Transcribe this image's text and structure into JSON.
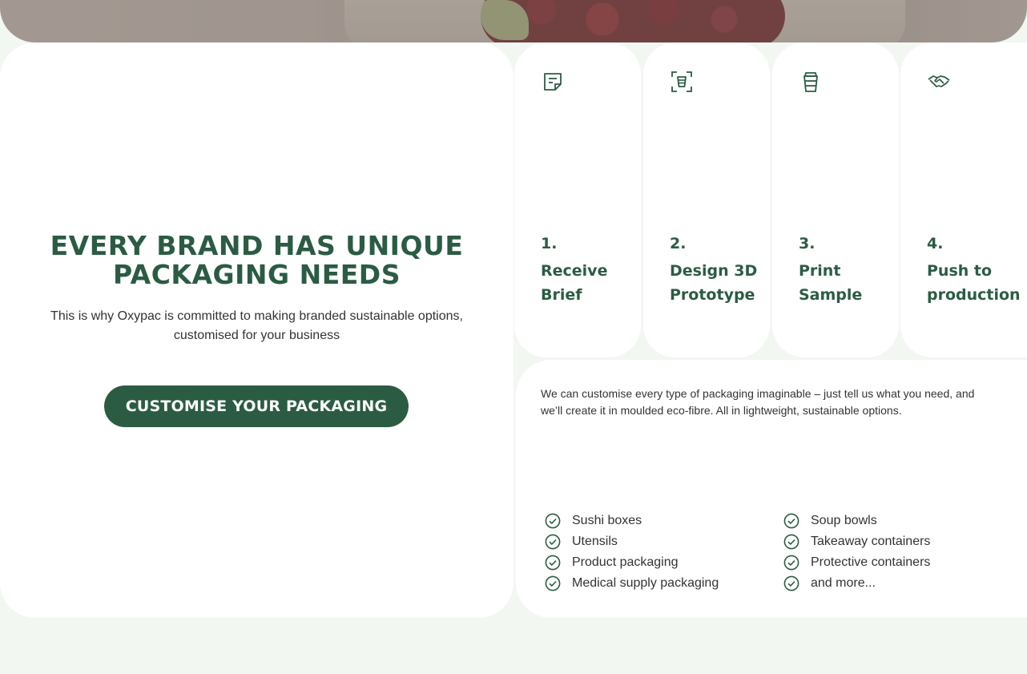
{
  "hero": {
    "alt": ""
  },
  "intro": {
    "title": "EVERY BRAND HAS UNIQUE PACKAGING NEEDS",
    "subtitle": "This is why Oxypac is committed to making branded sustainable options, customised for your business",
    "cta_label": "CUSTOMISE YOUR PACKAGING"
  },
  "steps": [
    {
      "number": "1.",
      "label": "Receive Brief",
      "icon": "document-icon"
    },
    {
      "number": "2.",
      "label": "Design 3D Prototype",
      "icon": "cup-scan-icon"
    },
    {
      "number": "3.",
      "label": "Print Sample",
      "icon": "cup-icon"
    },
    {
      "number": "4.",
      "label": "Push to production",
      "icon": "handshake-icon"
    }
  ],
  "description": {
    "text": "We can customise every type of packaging imaginable – just tell us what you need, and we’ll create it in moulded eco-fibre. All in lightweight, sustainable options.",
    "list_left": [
      "Sushi boxes",
      "Utensils",
      "Product packaging",
      "Medical supply packaging"
    ],
    "list_right": [
      "Soup bowls",
      "Takeaway containers",
      "Protective containers",
      "and more..."
    ]
  },
  "colors": {
    "brand_green": "#2b5c43",
    "background": "#f2f7f1",
    "card": "#ffffff"
  }
}
